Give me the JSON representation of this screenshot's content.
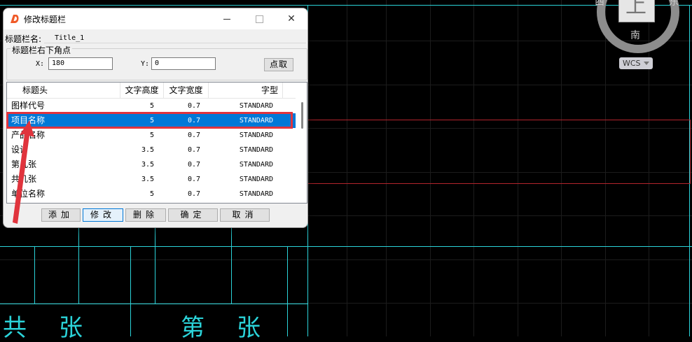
{
  "dialog": {
    "title": "修改标题栏",
    "close_glyph": "✕",
    "title_name_label": "标题栏名:",
    "title_name_value": "Title_1",
    "corner_group_label": "标题栏右下角点",
    "x_label": "X:",
    "x_value": "180",
    "y_label": "Y:",
    "y_value": "0",
    "pick_button": "点取",
    "columns": [
      "标题头",
      "文字高度",
      "文字宽度",
      "字型"
    ],
    "rows": [
      {
        "head": "图样代号",
        "height": "5",
        "width": "0.7",
        "font": "STANDARD"
      },
      {
        "head": "项目名称",
        "height": "5",
        "width": "0.7",
        "font": "STANDARD"
      },
      {
        "head": "产品名称",
        "height": "5",
        "width": "0.7",
        "font": "STANDARD"
      },
      {
        "head": "设计",
        "height": "3.5",
        "width": "0.7",
        "font": "STANDARD"
      },
      {
        "head": "第几张",
        "height": "3.5",
        "width": "0.7",
        "font": "STANDARD"
      },
      {
        "head": "共几张",
        "height": "3.5",
        "width": "0.7",
        "font": "STANDARD"
      },
      {
        "head": "单位名称",
        "height": "5",
        "width": "0.7",
        "font": "STANDARD"
      }
    ],
    "selected_row_index": 1,
    "buttons": {
      "add": "添加",
      "modify": "修改",
      "delete": "删除",
      "ok": "确定",
      "cancel": "取消"
    }
  },
  "viewcube": {
    "face": "上",
    "west": "西",
    "east": "东",
    "south": "南",
    "wcs": "WCS"
  },
  "cad": {
    "text_bottom_left": "共",
    "text_bottom_zhang1": "张",
    "text_bottom_mid": "第",
    "text_bottom_zhang2": "张"
  },
  "colors": {
    "cad_line": "#2bd3d9",
    "selection": "#0078d7",
    "highlight": "#e0343d",
    "red_region": "#b3242c"
  }
}
